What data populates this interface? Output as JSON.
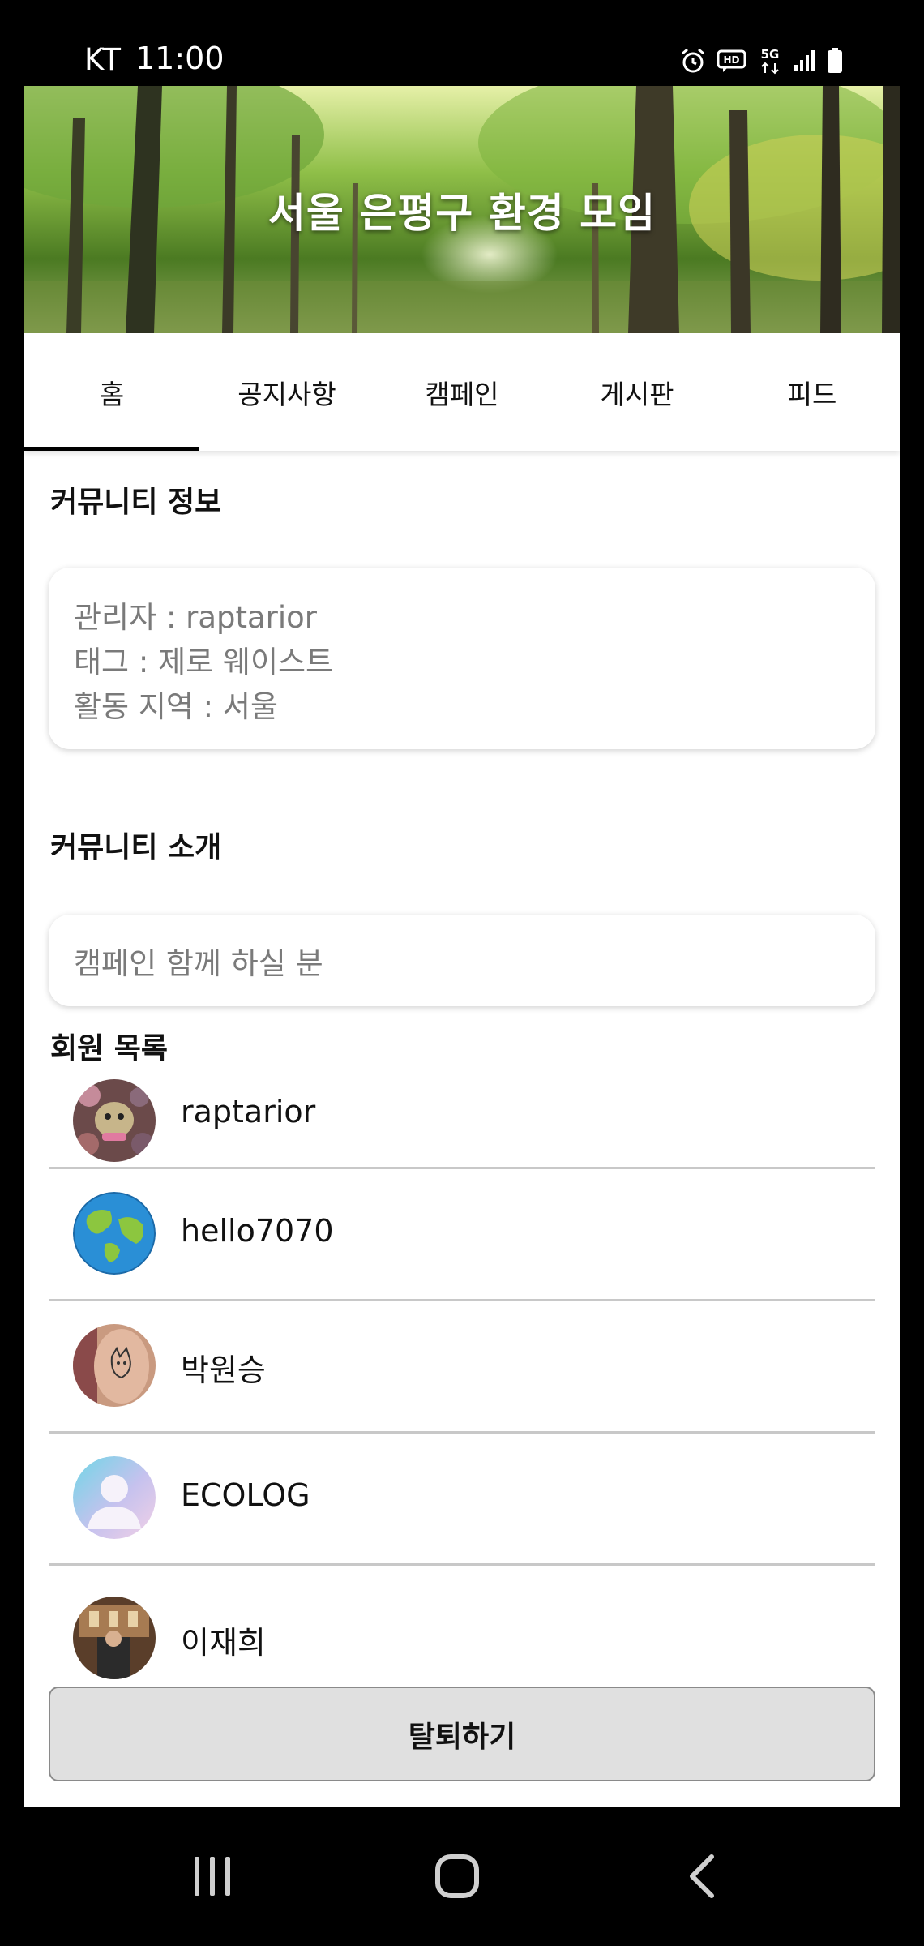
{
  "status_bar": {
    "carrier": "KT",
    "time": "11:00",
    "icons": [
      "alarm-icon",
      "hd-voice-icon",
      "5g-icon",
      "signal-icon",
      "battery-icon"
    ]
  },
  "header": {
    "title": "서울 은평구 환경 모임"
  },
  "tabs": [
    {
      "label": "홈",
      "active": true
    },
    {
      "label": "공지사항",
      "active": false
    },
    {
      "label": "캠페인",
      "active": false
    },
    {
      "label": "게시판",
      "active": false
    },
    {
      "label": "피드",
      "active": false
    }
  ],
  "community_info": {
    "heading": "커뮤니티 정보",
    "admin": "관리자 : raptarior",
    "tag": "태그 : 제로 웨이스트",
    "region": "활동 지역 : 서울"
  },
  "community_intro": {
    "heading": "커뮤니티 소개",
    "text": "캠페인 함께 하실 분"
  },
  "members": {
    "heading": "회원 목록",
    "list": [
      {
        "name": "raptarior",
        "avatar": "photo-avatar"
      },
      {
        "name": "hello7070",
        "avatar": "earth-avatar"
      },
      {
        "name": "박원승",
        "avatar": "photo-avatar"
      },
      {
        "name": "ECOLOG",
        "avatar": "default-avatar"
      },
      {
        "name": "이재희",
        "avatar": "photo-avatar"
      }
    ]
  },
  "leave_button": {
    "label": "탈퇴하기"
  },
  "nav_bar": {
    "icons": [
      "recent-apps-icon",
      "home-icon",
      "back-icon"
    ]
  }
}
